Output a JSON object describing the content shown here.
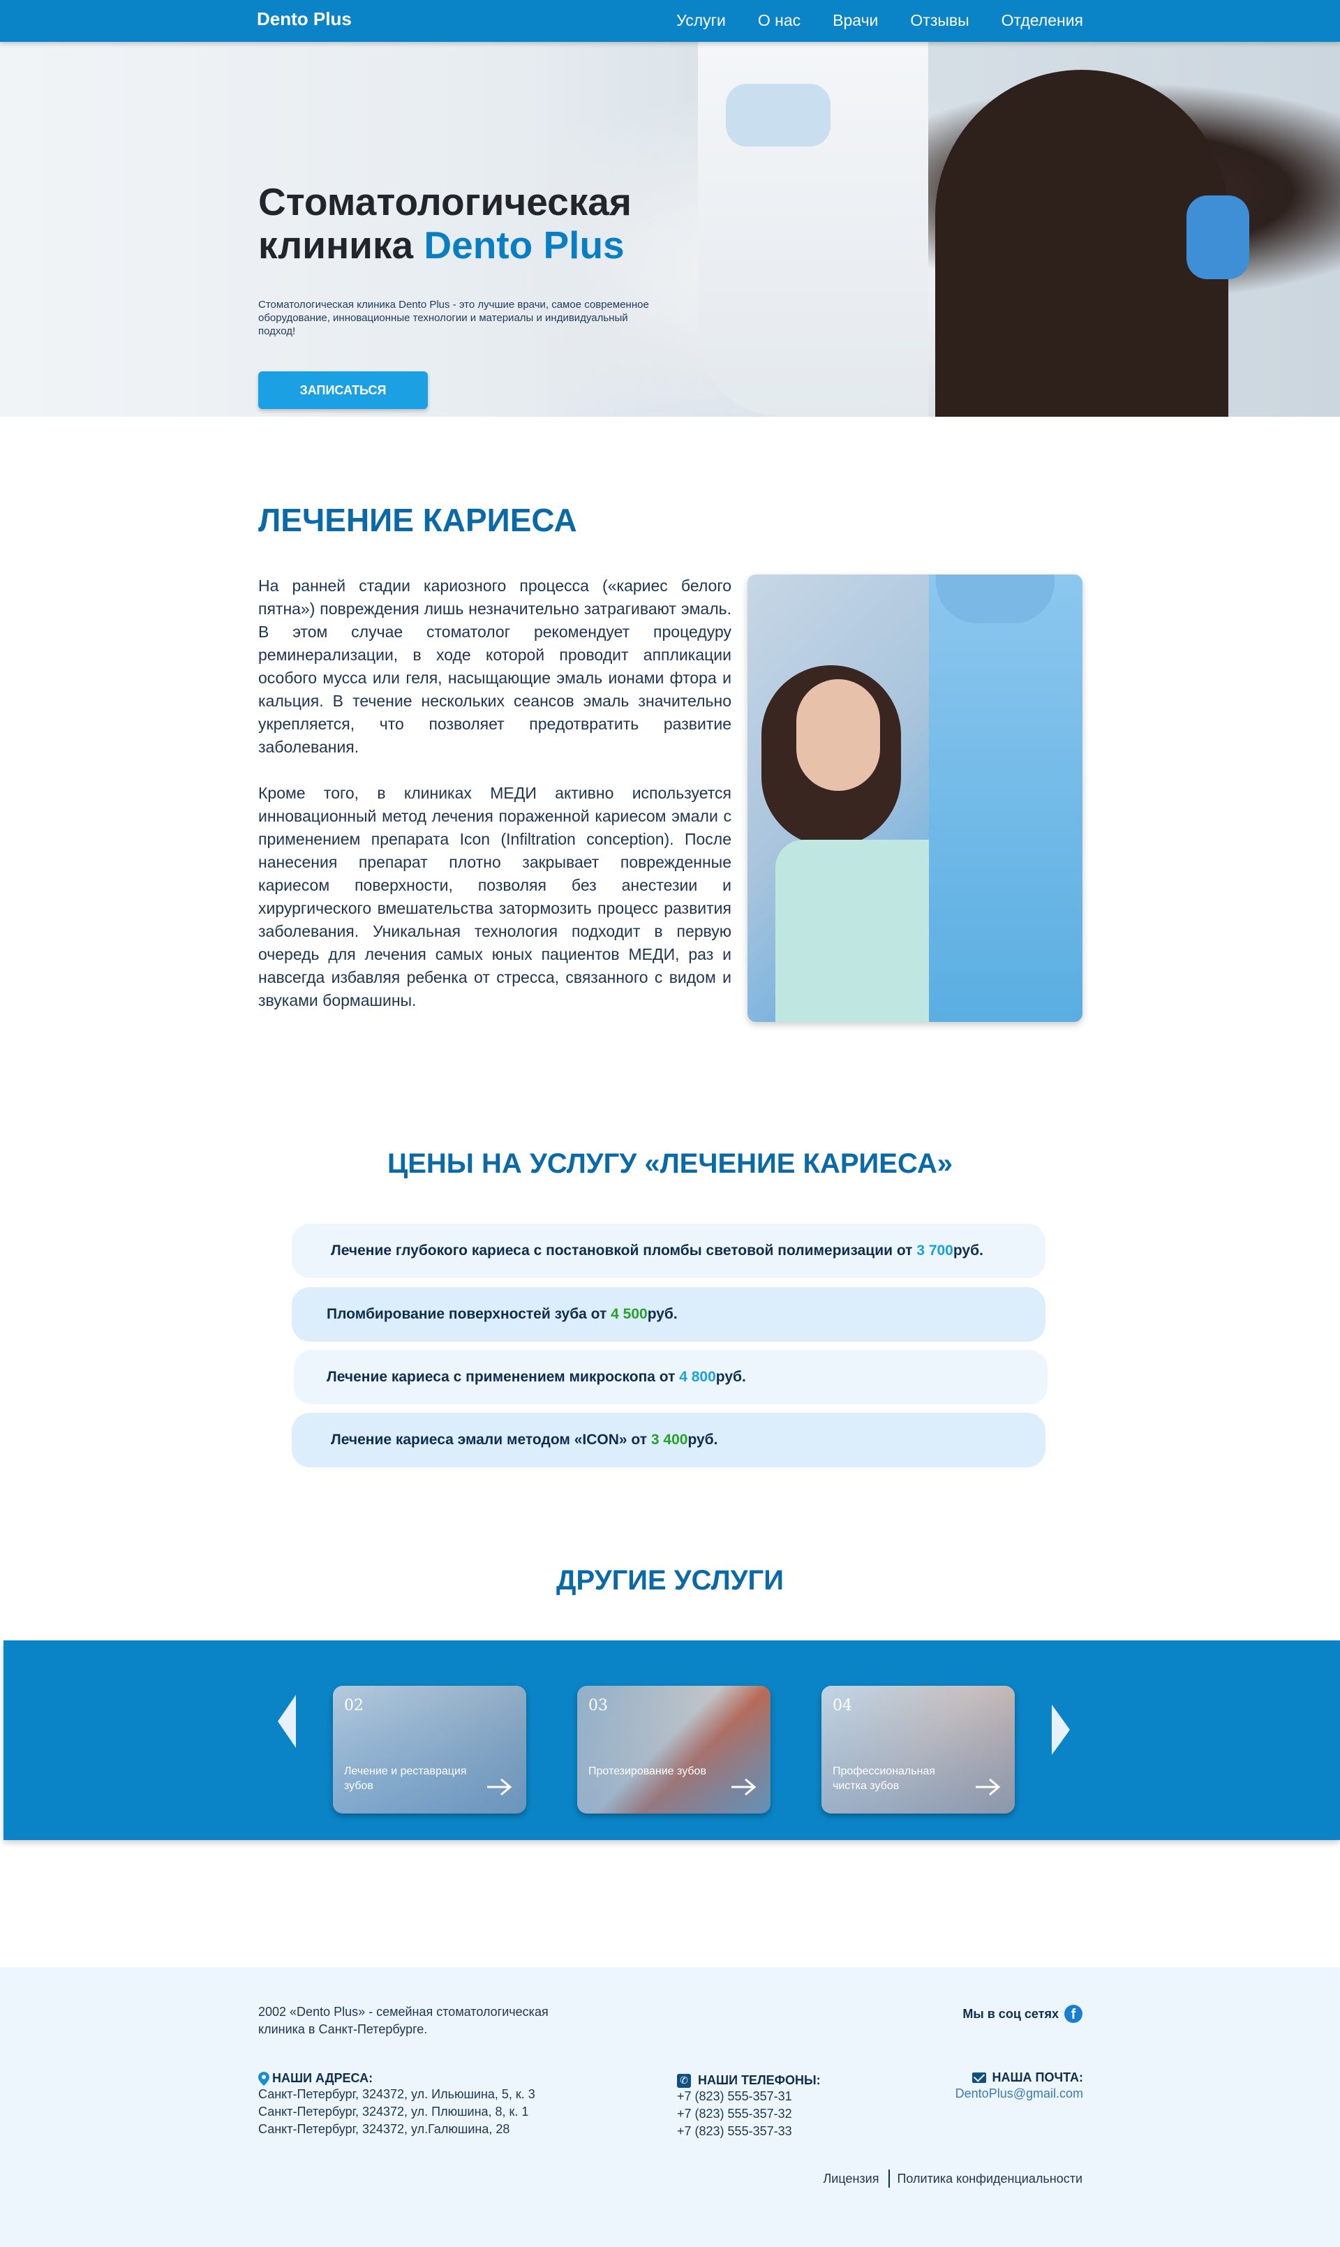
{
  "header": {
    "brand": "Dento Plus",
    "nav": [
      "Услуги",
      "О нас",
      "Врачи",
      "Отзывы",
      "Отделения"
    ]
  },
  "hero": {
    "title_line1": "Стоматологическая",
    "title_line2_prefix": "клиника ",
    "title_line2_accent": "Dento Plus",
    "lead": "Стоматологическая клиника Dento Plus - это лучшие врачи, самое современное оборудование, инновационные технологии и материалы и индивидуальный подход!",
    "cta": "ЗАПИСАТЬСЯ"
  },
  "caries": {
    "title": "ЛЕЧЕНИЕ КАРИЕСА",
    "paragraph1": "На ранней стадии кариозного процесса («кариес белого пятна») повреждения лишь незначительно затрагивают эмаль. В этом случае стоматолог рекомендует процедуру реминерализации, в ходе которой проводит аппликации особого мусса или геля, насыщающие эмаль ионами фтора и кальция. В течение нескольких сеансов эмаль значительно укрепляется, что позволяет предотвратить развитие заболевания.",
    "paragraph2": "Кроме того, в клиниках МЕДИ активно используется инновационный метод лечения пораженной кариесом эмали с применением препарата Icon (Infiltration conception). После нанесения препарат плотно закрывает поврежденные кариесом поверхности, позволяя без анестезии и хирургического вмешательства затормозить процесс развития заболевания. Уникальная технология подходит в первую очередь для лечения самых юных пациентов МЕДИ, раз и навсегда избавляя ребенка от стресса, связанного с видом и звуками бормашины."
  },
  "prices": {
    "title": "ЦЕНЫ НА УСЛУГУ «ЛЕЧЕНИЕ КАРИЕСА»",
    "items": [
      {
        "text": "Лечение глубокого кариеса с постановкой пломбы световой полимеризации от ",
        "amount": "3 700",
        "currency": " руб."
      },
      {
        "text": "Пломбирование поверхностей зуба от ",
        "amount": "4 500",
        "currency": " руб."
      },
      {
        "text": "Лечение кариеса с применением микроскопа от ",
        "amount": "4 800",
        "currency": " руб."
      },
      {
        "text": "Лечение кариеса эмали методом «ICON» от ",
        "amount": "3 400",
        "currency": " руб."
      }
    ]
  },
  "other_services": {
    "title": "ДРУГИЕ УСЛУГИ",
    "cards": [
      {
        "num": "02",
        "label": "Лечение и реставрация зубов"
      },
      {
        "num": "03",
        "label": "Протезирование зубов"
      },
      {
        "num": "04",
        "label": "Профессиональная чистка зубов"
      }
    ]
  },
  "footer": {
    "about": "2002 «Dento Plus» - семейная стоматологическая клиника в Санкт-Петербурге.",
    "social_label": "Мы в соц сетях",
    "addresses_title": "НАШИ АДРЕСА:",
    "addresses": [
      "Санкт-Петербург, 324372, ул. Ильюшина, 5, к. 3",
      "Санкт-Петербург, 324372, ул. Плюшина, 8, к. 1",
      "Санкт-Петербург, 324372, ул.Галюшина, 28"
    ],
    "phones_title": "НАШИ ТЕЛЕФОНЫ:",
    "phones": [
      "+7 (823) 555-357-31",
      "+7 (823) 555-357-32",
      "+7 (823) 555-357-33"
    ],
    "mail_title": "НАША ПОЧТА:",
    "mail": "DentoPlus@gmail.com",
    "links": [
      "Лицензия",
      "Политика конфиденциальности"
    ]
  },
  "colors": {
    "primary": "#0a84c6",
    "accent": "#1aa0e3",
    "heading": "#0a6aa7",
    "price_blue": "#1aa0e3",
    "price_green": "#27a12a",
    "footer_bg": "#eef6fd"
  },
  "icons": [
    "facebook-icon",
    "location-pin-icon",
    "phone-icon",
    "mail-icon",
    "arrow-left-icon",
    "arrow-right-icon"
  ]
}
